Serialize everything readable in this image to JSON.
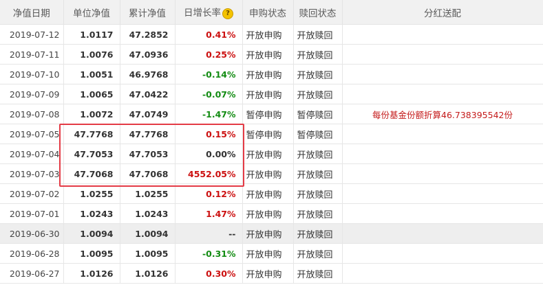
{
  "headers": {
    "date": "净值日期",
    "unit_nav": "单位净值",
    "acc_nav": "累计净值",
    "daily_growth": "日增长率",
    "purchase_status": "申购状态",
    "redeem_status": "赎回状态",
    "dividend": "分红送配"
  },
  "help_icon": "question-mark-icon",
  "colors": {
    "positive": "#cc1010",
    "negative": "#138c13",
    "highlight_box": "#e43a45",
    "row_highlight": "#eeeeee"
  },
  "rows": [
    {
      "date": "2019-07-12",
      "unit_nav": "1.0117",
      "acc_nav": "47.2852",
      "growth": "0.41%",
      "purchase": "开放申购",
      "redeem": "开放赎回",
      "dividend": ""
    },
    {
      "date": "2019-07-11",
      "unit_nav": "1.0076",
      "acc_nav": "47.0936",
      "growth": "0.25%",
      "purchase": "开放申购",
      "redeem": "开放赎回",
      "dividend": ""
    },
    {
      "date": "2019-07-10",
      "unit_nav": "1.0051",
      "acc_nav": "46.9768",
      "growth": "-0.14%",
      "purchase": "开放申购",
      "redeem": "开放赎回",
      "dividend": ""
    },
    {
      "date": "2019-07-09",
      "unit_nav": "1.0065",
      "acc_nav": "47.0422",
      "growth": "-0.07%",
      "purchase": "开放申购",
      "redeem": "开放赎回",
      "dividend": ""
    },
    {
      "date": "2019-07-08",
      "unit_nav": "1.0072",
      "acc_nav": "47.0749",
      "growth": "-1.47%",
      "purchase": "暂停申购",
      "redeem": "暂停赎回",
      "dividend": "每份基金份额折算46.738395542份"
    },
    {
      "date": "2019-07-05",
      "unit_nav": "47.7768",
      "acc_nav": "47.7768",
      "growth": "0.15%",
      "purchase": "暂停申购",
      "redeem": "暂停赎回",
      "dividend": ""
    },
    {
      "date": "2019-07-04",
      "unit_nav": "47.7053",
      "acc_nav": "47.7053",
      "growth": "0.00%",
      "purchase": "开放申购",
      "redeem": "开放赎回",
      "dividend": ""
    },
    {
      "date": "2019-07-03",
      "unit_nav": "47.7068",
      "acc_nav": "47.7068",
      "growth": "4552.05%",
      "purchase": "开放申购",
      "redeem": "开放赎回",
      "dividend": ""
    },
    {
      "date": "2019-07-02",
      "unit_nav": "1.0255",
      "acc_nav": "1.0255",
      "growth": "0.12%",
      "purchase": "开放申购",
      "redeem": "开放赎回",
      "dividend": ""
    },
    {
      "date": "2019-07-01",
      "unit_nav": "1.0243",
      "acc_nav": "1.0243",
      "growth": "1.47%",
      "purchase": "开放申购",
      "redeem": "开放赎回",
      "dividend": ""
    },
    {
      "date": "2019-06-30",
      "unit_nav": "1.0094",
      "acc_nav": "1.0094",
      "growth": "--",
      "purchase": "开放申购",
      "redeem": "开放赎回",
      "dividend": ""
    },
    {
      "date": "2019-06-28",
      "unit_nav": "1.0095",
      "acc_nav": "1.0095",
      "growth": "-0.31%",
      "purchase": "开放申购",
      "redeem": "开放赎回",
      "dividend": ""
    },
    {
      "date": "2019-06-27",
      "unit_nav": "1.0126",
      "acc_nav": "1.0126",
      "growth": "0.30%",
      "purchase": "开放申购",
      "redeem": "开放赎回",
      "dividend": ""
    }
  ]
}
